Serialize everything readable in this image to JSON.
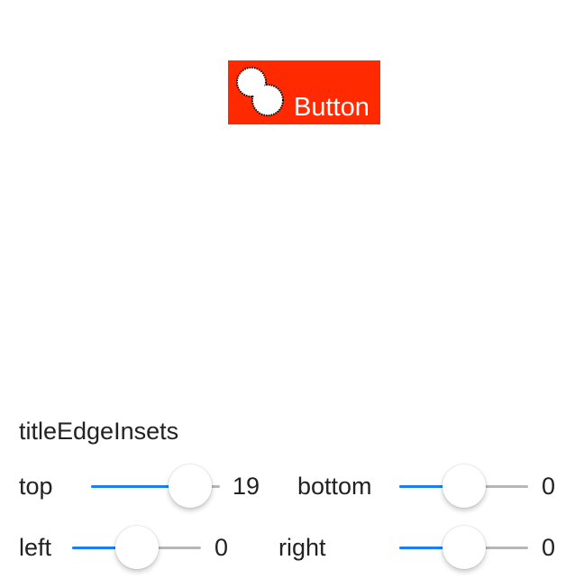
{
  "demo_button": {
    "title": "Button",
    "background_color": "#ff2a00",
    "icon": "double-circle-icon"
  },
  "insets_panel": {
    "title": "titleEdgeInsets",
    "top": {
      "label": "top",
      "value": "19",
      "fraction": 0.77
    },
    "bottom": {
      "label": "bottom",
      "value": "0",
      "fraction": 0.5
    },
    "left": {
      "label": "left",
      "value": "0",
      "fraction": 0.5
    },
    "right": {
      "label": "right",
      "value": "0",
      "fraction": 0.5
    }
  },
  "colors": {
    "slider_fill": "#1a7ff0",
    "slider_track": "#b7b7b7"
  }
}
